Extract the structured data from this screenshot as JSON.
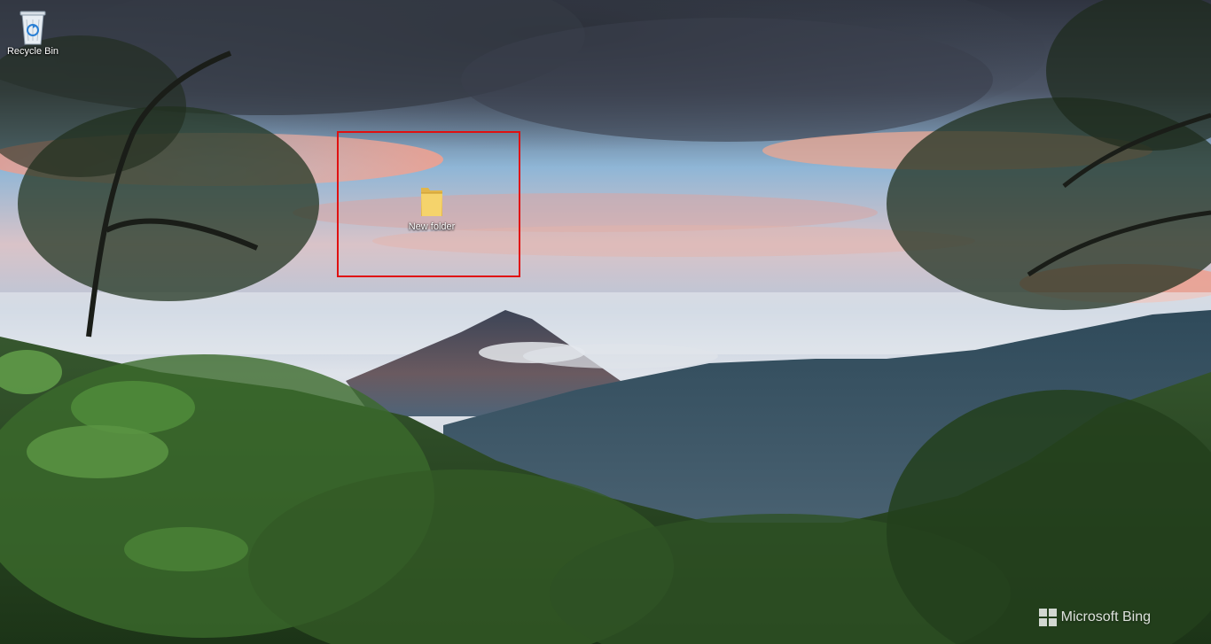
{
  "desktop": {
    "icons": [
      {
        "label": "Recycle Bin",
        "icon": "recycle-bin-icon"
      },
      {
        "label": "New folder",
        "icon": "folder-icon"
      }
    ],
    "watermark": "Microsoft Bing",
    "highlight_color": "#e01010"
  },
  "colors": {
    "sky_top": "#3e4656",
    "sky_mid": "#8fb8d8",
    "cloud_pink": "#e6a79a",
    "mountain": "#4a5a6e",
    "forest_dark": "#1e3a1c",
    "forest_mid": "#3e6a2a"
  }
}
